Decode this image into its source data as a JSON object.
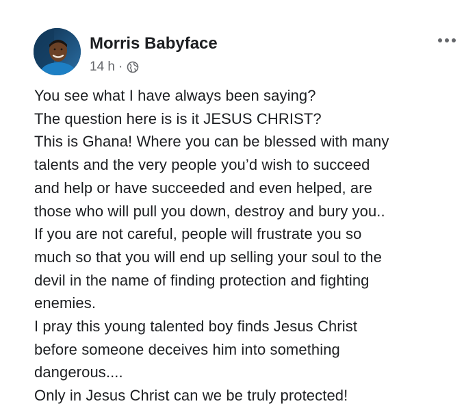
{
  "post": {
    "author": {
      "name": "Morris Babyface",
      "avatar_icon": "profile-photo"
    },
    "meta": {
      "time": "14 h",
      "separator": "·",
      "privacy_icon": "globe-icon"
    },
    "more_icon": "ellipsis-icon",
    "lines": [
      "You see what I have always been saying?",
      "The question here is is it JESUS CHRIST?",
      "This is Ghana! Where you can be blessed with many",
      "talents and the very people you’d wish to succeed",
      "and help or have succeeded and even helped, are",
      "those who will pull you down, destroy and bury you..",
      "If you are not careful, people will frustrate you so",
      "much so that you will end up selling your soul to the",
      "devil in the name of finding protection and fighting",
      "enemies.",
      "I pray this young talented boy finds Jesus Christ",
      "before someone deceives him into something",
      "dangerous....",
      "Only in Jesus Christ can we be truly protected!"
    ]
  },
  "colors": {
    "text": "#1c1e21",
    "secondary": "#65676b",
    "background": "#ffffff"
  }
}
